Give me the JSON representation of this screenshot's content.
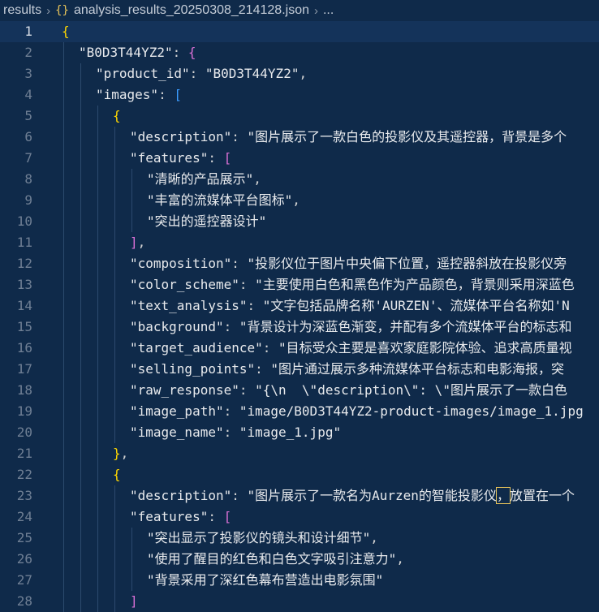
{
  "breadcrumb": {
    "folder": "results",
    "file": "analysis_results_20250308_214128.json",
    "more": "..."
  },
  "lines": [
    {
      "n": "1",
      "indent": 0,
      "tokens": [
        {
          "t": "{",
          "c": "b1"
        }
      ]
    },
    {
      "n": "2",
      "indent": 1,
      "tokens": [
        {
          "t": "\"B0D3T44YZ2\"",
          "c": "sv"
        },
        {
          "t": ": ",
          "c": "p"
        },
        {
          "t": "{",
          "c": "b2"
        }
      ]
    },
    {
      "n": "3",
      "indent": 2,
      "tokens": [
        {
          "t": "\"product_id\"",
          "c": "sv"
        },
        {
          "t": ": ",
          "c": "p"
        },
        {
          "t": "\"B0D3T44YZ2\"",
          "c": "sv"
        },
        {
          "t": ",",
          "c": "p"
        }
      ]
    },
    {
      "n": "4",
      "indent": 2,
      "tokens": [
        {
          "t": "\"images\"",
          "c": "sv"
        },
        {
          "t": ": ",
          "c": "p"
        },
        {
          "t": "[",
          "c": "b3"
        }
      ]
    },
    {
      "n": "5",
      "indent": 3,
      "tokens": [
        {
          "t": "{",
          "c": "b1"
        }
      ]
    },
    {
      "n": "6",
      "indent": 4,
      "tokens": [
        {
          "t": "\"description\"",
          "c": "sv"
        },
        {
          "t": ": ",
          "c": "p"
        },
        {
          "t": "\"图片展示了一款白色的投影仪及其遥控器，背景是多个",
          "c": "sv"
        }
      ]
    },
    {
      "n": "7",
      "indent": 4,
      "tokens": [
        {
          "t": "\"features\"",
          "c": "sv"
        },
        {
          "t": ": ",
          "c": "p"
        },
        {
          "t": "[",
          "c": "b2"
        }
      ]
    },
    {
      "n": "8",
      "indent": 5,
      "tokens": [
        {
          "t": "\"清晰的产品展示\"",
          "c": "sv"
        },
        {
          "t": ",",
          "c": "p"
        }
      ]
    },
    {
      "n": "9",
      "indent": 5,
      "tokens": [
        {
          "t": "\"丰富的流媒体平台图标\"",
          "c": "sv"
        },
        {
          "t": ",",
          "c": "p"
        }
      ]
    },
    {
      "n": "10",
      "indent": 5,
      "tokens": [
        {
          "t": "\"突出的遥控器设计\"",
          "c": "sv"
        }
      ]
    },
    {
      "n": "11",
      "indent": 4,
      "tokens": [
        {
          "t": "]",
          "c": "b2"
        },
        {
          "t": ",",
          "c": "p"
        }
      ]
    },
    {
      "n": "12",
      "indent": 4,
      "tokens": [
        {
          "t": "\"composition\"",
          "c": "sv"
        },
        {
          "t": ": ",
          "c": "p"
        },
        {
          "t": "\"投影仪位于图片中央偏下位置，遥控器斜放在投影仪旁",
          "c": "sv"
        }
      ]
    },
    {
      "n": "13",
      "indent": 4,
      "tokens": [
        {
          "t": "\"color_scheme\"",
          "c": "sv"
        },
        {
          "t": ": ",
          "c": "p"
        },
        {
          "t": "\"主要使用白色和黑色作为产品颜色，背景则采用深蓝色",
          "c": "sv"
        }
      ]
    },
    {
      "n": "14",
      "indent": 4,
      "tokens": [
        {
          "t": "\"text_analysis\"",
          "c": "sv"
        },
        {
          "t": ": ",
          "c": "p"
        },
        {
          "t": "\"文字包括品牌名称'AURZEN'、流媒体平台名称如'N",
          "c": "sv"
        }
      ]
    },
    {
      "n": "15",
      "indent": 4,
      "tokens": [
        {
          "t": "\"background\"",
          "c": "sv"
        },
        {
          "t": ": ",
          "c": "p"
        },
        {
          "t": "\"背景设计为深蓝色渐变，并配有多个流媒体平台的标志和",
          "c": "sv"
        }
      ]
    },
    {
      "n": "16",
      "indent": 4,
      "tokens": [
        {
          "t": "\"target_audience\"",
          "c": "sv"
        },
        {
          "t": ": ",
          "c": "p"
        },
        {
          "t": "\"目标受众主要是喜欢家庭影院体验、追求高质量视",
          "c": "sv"
        }
      ]
    },
    {
      "n": "17",
      "indent": 4,
      "tokens": [
        {
          "t": "\"selling_points\"",
          "c": "sv"
        },
        {
          "t": ": ",
          "c": "p"
        },
        {
          "t": "\"图片通过展示多种流媒体平台标志和电影海报，突",
          "c": "sv"
        }
      ]
    },
    {
      "n": "18",
      "indent": 4,
      "tokens": [
        {
          "t": "\"raw_response\"",
          "c": "sv"
        },
        {
          "t": ": ",
          "c": "p"
        },
        {
          "t": "\"{\\n  \\\"description\\\": \\\"图片展示了一款白色",
          "c": "sv"
        }
      ]
    },
    {
      "n": "19",
      "indent": 4,
      "tokens": [
        {
          "t": "\"image_path\"",
          "c": "sv"
        },
        {
          "t": ": ",
          "c": "p"
        },
        {
          "t": "\"image/B0D3T44YZ2-product-images/image_1.jpg",
          "c": "sv"
        }
      ]
    },
    {
      "n": "20",
      "indent": 4,
      "tokens": [
        {
          "t": "\"image_name\"",
          "c": "sv"
        },
        {
          "t": ": ",
          "c": "p"
        },
        {
          "t": "\"image_1.jpg\"",
          "c": "sv"
        }
      ]
    },
    {
      "n": "21",
      "indent": 3,
      "tokens": [
        {
          "t": "}",
          "c": "b1"
        },
        {
          "t": ",",
          "c": "p"
        }
      ]
    },
    {
      "n": "22",
      "indent": 3,
      "tokens": [
        {
          "t": "{",
          "c": "b1"
        }
      ]
    },
    {
      "n": "23",
      "indent": 4,
      "tokens": [
        {
          "t": "\"description\"",
          "c": "sv"
        },
        {
          "t": ": ",
          "c": "p"
        },
        {
          "t": "\"图片展示了一款名为Aurzen的智能投影仪",
          "c": "sv"
        },
        {
          "t": "，",
          "c": "sv",
          "cursor": true
        },
        {
          "t": "放置在一个",
          "c": "sv"
        }
      ]
    },
    {
      "n": "24",
      "indent": 4,
      "tokens": [
        {
          "t": "\"features\"",
          "c": "sv"
        },
        {
          "t": ": ",
          "c": "p"
        },
        {
          "t": "[",
          "c": "b2"
        }
      ]
    },
    {
      "n": "25",
      "indent": 5,
      "tokens": [
        {
          "t": "\"突出显示了投影仪的镜头和设计细节\"",
          "c": "sv"
        },
        {
          "t": ",",
          "c": "p"
        }
      ]
    },
    {
      "n": "26",
      "indent": 5,
      "tokens": [
        {
          "t": "\"使用了醒目的红色和白色文字吸引注意力\"",
          "c": "sv"
        },
        {
          "t": ",",
          "c": "p"
        }
      ]
    },
    {
      "n": "27",
      "indent": 5,
      "tokens": [
        {
          "t": "\"背景采用了深红色幕布营造出电影氛围\"",
          "c": "sv"
        }
      ]
    },
    {
      "n": "28",
      "indent": 4,
      "tokens": [
        {
          "t": "]",
          "c": "b2"
        }
      ]
    }
  ],
  "current_line": "1",
  "colors": {
    "background": "#0f2a4a",
    "string": "#e8eaed",
    "bracket_gold": "#ffd700",
    "bracket_purple": "#da70d6",
    "bracket_blue": "#3b9cff"
  }
}
